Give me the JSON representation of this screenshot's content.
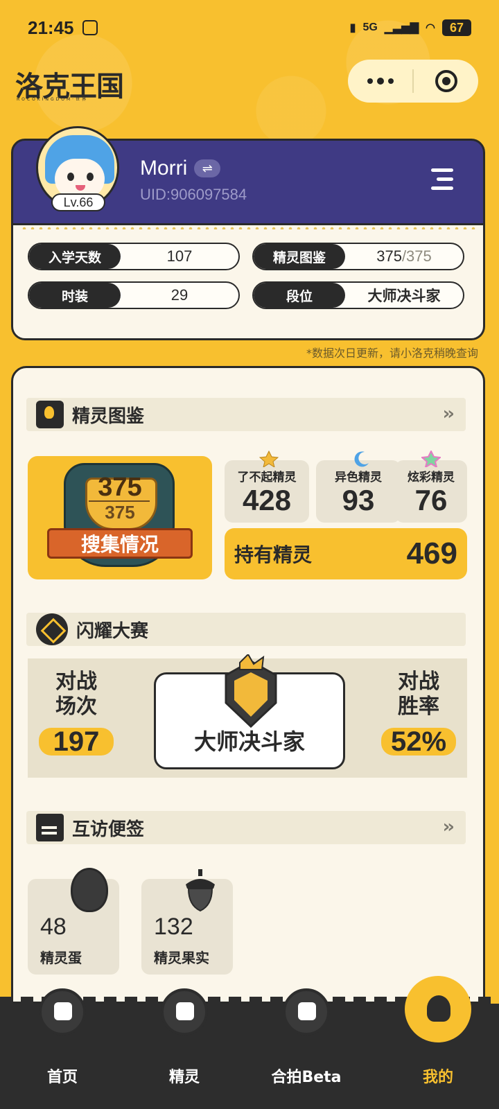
{
  "status_bar": {
    "time": "21:45",
    "network": "5G",
    "battery": "67"
  },
  "header": {
    "app_title": "洛克王国",
    "app_subtitle": "ROCOKINGDOM·世界"
  },
  "profile": {
    "username": "Morri",
    "uid": "UID:906097584",
    "level": "Lv.66",
    "swap_icon": "⇌"
  },
  "stats": {
    "enroll_label": "入学天数",
    "enroll_value": "107",
    "pokedex_label": "精灵图鉴",
    "pokedex_value": "375",
    "pokedex_total": "/375",
    "fashion_label": "时装",
    "fashion_value": "29",
    "rank_label": "段位",
    "rank_value": "大师决斗家",
    "note": "*数据次日更新，请小洛克稍晚查询"
  },
  "pokedex": {
    "title": "精灵图鉴",
    "more": "»",
    "collected": "375",
    "collected_total": "375",
    "collection_label": "搜集情况",
    "cards": [
      {
        "label": "了不起精灵",
        "value": "428"
      },
      {
        "label": "异色精灵",
        "value": "93"
      },
      {
        "label": "炫彩精灵",
        "value": "76"
      }
    ],
    "owned_label": "持有精灵",
    "owned_value": "469"
  },
  "contest": {
    "title": "闪耀大赛",
    "battles_label": "对战\n场次",
    "battles_label_1": "对战",
    "battles_label_2": "场次",
    "battles_value": "197",
    "rank": "大师决斗家",
    "winrate_label_1": "对战",
    "winrate_label_2": "胜率",
    "winrate_value": "52%"
  },
  "visits": {
    "title": "互访便签",
    "more": "»",
    "items": [
      {
        "value": "48",
        "label": "精灵蛋"
      },
      {
        "value": "132",
        "label": "精灵果实"
      }
    ]
  },
  "nav": {
    "items": [
      {
        "label": "首页"
      },
      {
        "label": "精灵"
      },
      {
        "label": "合拍Beta"
      },
      {
        "label": "我的"
      }
    ]
  },
  "colors": {
    "accent": "#F8C02F",
    "header": "#3F3A84",
    "dark": "#2D2D2D",
    "cream": "#FBF6EA"
  }
}
